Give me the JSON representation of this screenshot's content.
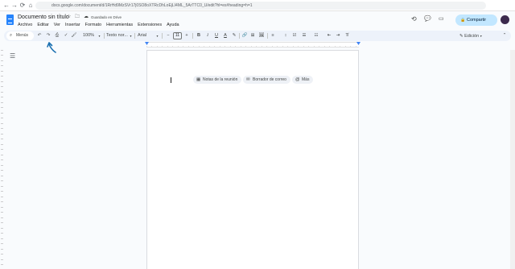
{
  "browser": {
    "url": "docs.google.com/document/d/1RrHd9MzSVr17j0SO8oXTRcDhLoEjLI4ML_5ArTTC0_U/edit?hl=es#heading=h=1",
    "back_glyph": "←",
    "forward_glyph": "→",
    "reload_glyph": "⟳",
    "home_glyph": "⌂"
  },
  "header": {
    "doc_title": "Documento sin título",
    "saved_status": "Guardado en Drive",
    "star_glyph": "☆",
    "folder_glyph": "🗀",
    "cloud_glyph": "☁",
    "history_glyph": "⟲",
    "comment_glyph": "💬",
    "meet_glyph": "▭",
    "share_label": "Compartir",
    "lock_glyph": "🔒",
    "menu": [
      "Archivo",
      "Editar",
      "Ver",
      "Insertar",
      "Formato",
      "Herramientas",
      "Extensiones",
      "Ayuda"
    ]
  },
  "toolbar": {
    "search_label": "Menús",
    "search_glyph": "⌕",
    "undo_glyph": "↶",
    "redo_glyph": "↷",
    "print_glyph": "⎙",
    "spell_glyph": "✓",
    "paint_glyph": "🖌",
    "zoom": "100%",
    "style": "Texto nor...",
    "font": "Arial",
    "font_size": "11",
    "minus_glyph": "−",
    "plus_glyph": "+",
    "bold": "B",
    "italic": "I",
    "underline": "U",
    "text_color": "A",
    "highlight_glyph": "✎",
    "link_glyph": "🔗",
    "comment_glyph": "⊞",
    "image_glyph": "🖼",
    "align_glyph": "≡",
    "spacing_glyph": "↕",
    "checklist_glyph": "☑",
    "bullet_glyph": "☰",
    "numbered_glyph": "☷",
    "indent_dec_glyph": "⇤",
    "indent_inc_glyph": "⇥",
    "clear_glyph": "T̸",
    "edit_mode": "Edición",
    "pencil_glyph": "✎",
    "collapse_glyph": "⌃"
  },
  "chips": [
    {
      "icon": "▦",
      "label": "Notas de la reunión"
    },
    {
      "icon": "✉",
      "label": "Borrador de correo"
    },
    {
      "icon": "@",
      "label": "Más"
    }
  ],
  "sidebar": {
    "outline_glyph": "☰"
  },
  "colors": {
    "accent": "#2684fc",
    "share_bg": "#c2e7ff",
    "toolbar_bg": "#edf2fa",
    "annotation": "#1a6fb0"
  }
}
